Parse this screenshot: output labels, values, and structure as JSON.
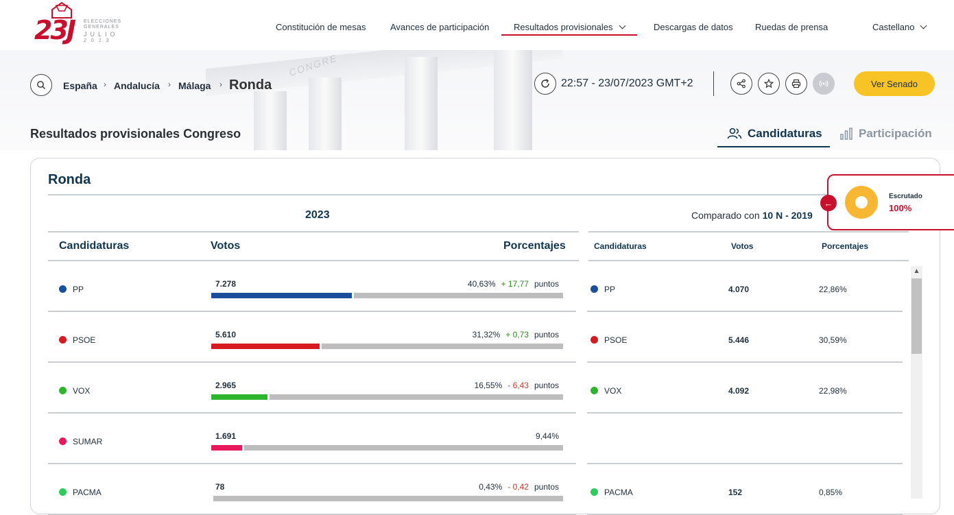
{
  "logo": {
    "number": "23J",
    "line1": "ELECCIONES GENERALES",
    "line2": "JULIO",
    "line3": "2023"
  },
  "nav": {
    "items": [
      "Constitución de mesas",
      "Avances de participación",
      "Resultados provisionales",
      "Descargas de datos",
      "Ruedas de prensa"
    ],
    "language": "Castellano"
  },
  "breadcrumb": {
    "items": [
      "España",
      "Andalucía",
      "Málaga"
    ],
    "current": "Ronda"
  },
  "update_time": "22:57 - 23/07/2023 GMT+2",
  "ver_senado": "Ver Senado",
  "page_title": "Resultados provisionales Congreso",
  "tabs": [
    "Candidaturas",
    "Participación"
  ],
  "card": {
    "title": "Ronda",
    "year": "2023",
    "compared_label": "Comparado con",
    "compared_value": "10 N - 2019",
    "headers": {
      "candidaturas": "Candidaturas",
      "votos": "Votos",
      "porcentajes": "Porcentajes"
    }
  },
  "escrutado": {
    "label": "Escrutado",
    "value": "100%"
  },
  "colors": {
    "accent_red": "#c8102e",
    "navy": "#0f3550",
    "yellow": "#f7c325",
    "positive": "#2e8b1e",
    "negative": "#c0392b"
  },
  "parties": [
    {
      "name": "PP",
      "color": "#1b4f9c",
      "votes": "7.278",
      "pct": "40,63%",
      "diff": "+ 17,77",
      "diff_sign": "pos",
      "unit": "puntos",
      "fill": 0.4063,
      "prev_votes": "4.070",
      "prev_pct": "22,86%"
    },
    {
      "name": "PSOE",
      "color": "#d71920",
      "votes": "5.610",
      "pct": "31,32%",
      "diff": "+ 0,73",
      "diff_sign": "pos",
      "unit": "puntos",
      "fill": 0.3132,
      "prev_votes": "5.446",
      "prev_pct": "30,59%"
    },
    {
      "name": "VOX",
      "color": "#2db52d",
      "votes": "2.965",
      "pct": "16,55%",
      "diff": "- 6,43",
      "diff_sign": "neg",
      "unit": "puntos",
      "fill": 0.1655,
      "prev_votes": "4.092",
      "prev_pct": "22,98%"
    },
    {
      "name": "SUMAR",
      "color": "#e8185c",
      "votes": "1.691",
      "pct": "9,44%",
      "diff": "",
      "diff_sign": "",
      "unit": "",
      "fill": 0.0944,
      "prev_votes": "",
      "prev_pct": ""
    },
    {
      "name": "PACMA",
      "color": "#2ecc5a",
      "votes": "78",
      "pct": "0,43%",
      "diff": "- 0,42",
      "diff_sign": "neg",
      "unit": "puntos",
      "fill": 0.0043,
      "prev_votes": "152",
      "prev_pct": "0,85%"
    }
  ]
}
